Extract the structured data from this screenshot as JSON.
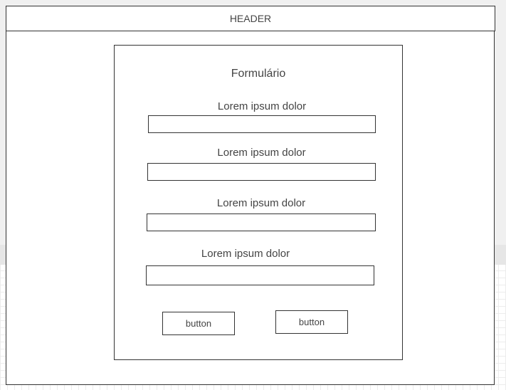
{
  "header": {
    "label": "HEADER"
  },
  "form": {
    "title": "Formulário",
    "fields": [
      {
        "label": "Lorem ipsum dolor",
        "value": ""
      },
      {
        "label": "Lorem ipsum dolor",
        "value": ""
      },
      {
        "label": "Lorem ipsum dolor",
        "value": ""
      },
      {
        "label": "Lorem ipsum dolor",
        "value": ""
      }
    ],
    "buttons": [
      {
        "label": "button"
      },
      {
        "label": "button"
      }
    ]
  }
}
